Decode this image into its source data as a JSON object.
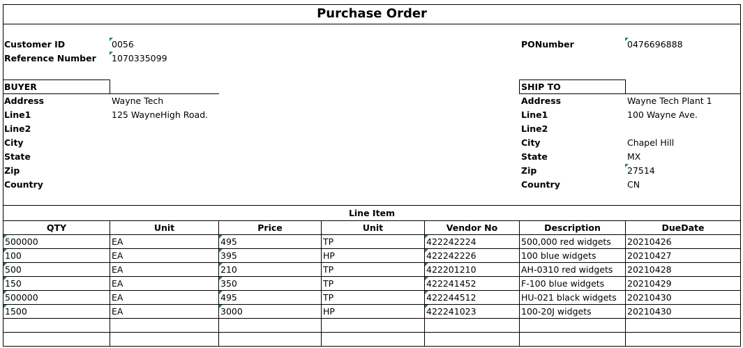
{
  "title": "Purchase Order",
  "customer": {
    "id_label": "Customer ID",
    "id_value": "0056",
    "ref_label": "Reference Number",
    "ref_value": "1070335099",
    "po_label": "PONumber",
    "po_value": "0476696888"
  },
  "buyer": {
    "header": "BUYER",
    "fields": [
      {
        "label": "Address",
        "value": "Wayne Tech"
      },
      {
        "label": "Line1",
        "value": "125 WayneHigh Road."
      },
      {
        "label": "Line2",
        "value": ""
      },
      {
        "label": "City",
        "value": ""
      },
      {
        "label": "State",
        "value": ""
      },
      {
        "label": "Zip",
        "value": ""
      },
      {
        "label": "Country",
        "value": ""
      }
    ]
  },
  "ship_to": {
    "header": "SHIP TO",
    "fields": [
      {
        "label": "Address",
        "value": "Wayne Tech Plant 1"
      },
      {
        "label": "Line1",
        "value": "100 Wayne Ave."
      },
      {
        "label": "Line2",
        "value": ""
      },
      {
        "label": "City",
        "value": "Chapel Hill"
      },
      {
        "label": "State",
        "value": "MX"
      },
      {
        "label": "Zip",
        "value": "27514"
      },
      {
        "label": "Country",
        "value": "CN"
      }
    ]
  },
  "line_items": {
    "caption": "Line Item",
    "columns": [
      "QTY",
      "Unit",
      "Price",
      "Unit",
      "Vendor No",
      "Description",
      "DueDate"
    ],
    "rows": [
      [
        "500000",
        "EA",
        "495",
        "TP",
        "422242224",
        "500,000 red widgets",
        "20210426"
      ],
      [
        "100",
        "EA",
        "395",
        "HP",
        "422242226",
        "100 blue widgets",
        "20210427"
      ],
      [
        "500",
        "EA",
        "210",
        "TP",
        "422201210",
        "AH-0310 red widgets",
        "20210428"
      ],
      [
        "150",
        "EA",
        "350",
        "TP",
        "422241452",
        "F-100 blue widgets",
        "20210429"
      ],
      [
        "500000",
        "EA",
        "495",
        "TP",
        "422244512",
        "HU-021 black widgets",
        "20210430"
      ],
      [
        "1500",
        "EA",
        "3000",
        "HP",
        "422241023",
        "100-20J widgets",
        "20210430"
      ],
      [
        "",
        "",
        "",
        "",
        "",
        "",
        ""
      ],
      [
        "",
        "",
        "",
        "",
        "",
        "",
        ""
      ]
    ]
  },
  "colors": {
    "border": "#000000",
    "number_marker": "#1e8c3a"
  }
}
